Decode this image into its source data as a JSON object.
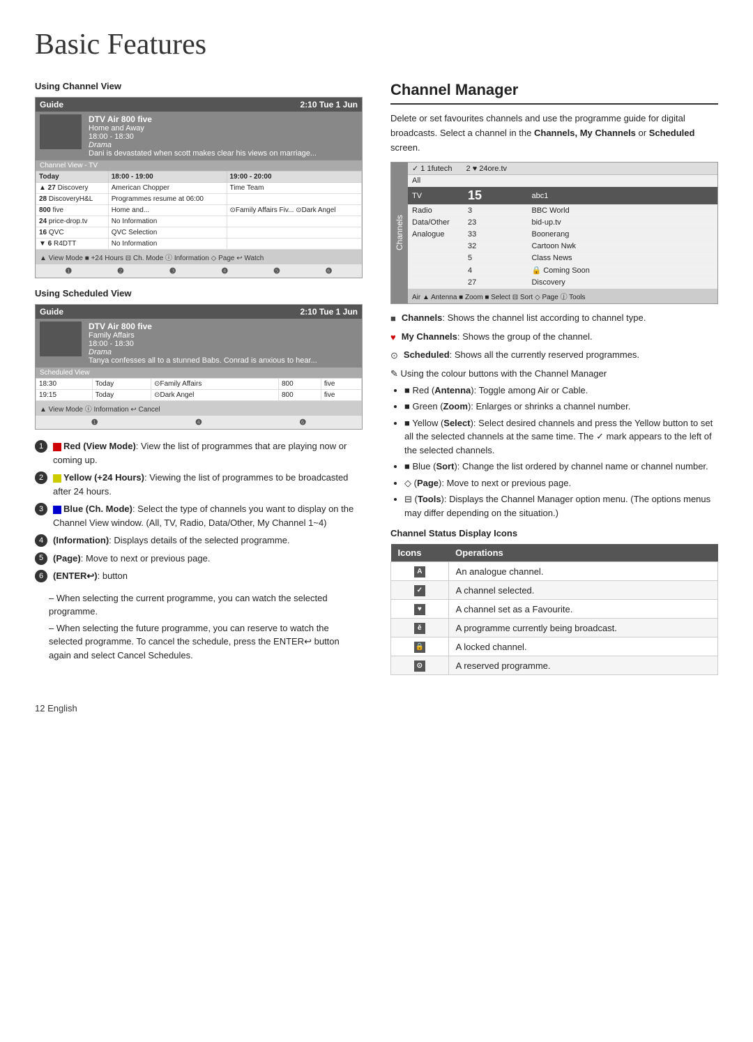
{
  "page": {
    "title": "Basic Features",
    "footer": "12   English"
  },
  "left_col": {
    "channel_view_label": "Using Channel View",
    "scheduled_view_label": "Using Scheduled View",
    "guide": {
      "header_title": "Guide",
      "header_time": "2:10 Tue 1 Jun",
      "show_title": "DTV Air 800 five",
      "show_subtitle": "Home and Away",
      "show_time": "18:00 - 18:30",
      "show_genre": "Drama",
      "show_desc": "Dani is devastated when scott makes clear his views on marriage...",
      "view_label": "Channel View - TV",
      "time_col1": "Today",
      "time_col2": "18:00 - 19:00",
      "time_col3": "19:00 - 20:00",
      "channels": [
        {
          "num": "▲ 27",
          "name": "Discovery",
          "p1": "American Chopper",
          "p2": "Time Team"
        },
        {
          "num": "28",
          "name": "DiscoveryH&L",
          "p1": "Programmes resume at 06:00",
          "p2": ""
        },
        {
          "num": "800",
          "name": "five",
          "p1": "Home and...",
          "p2": "⊙Family Affairs  Fiv...  ⊙Dark Angel"
        },
        {
          "num": "24",
          "name": "price-drop.tv",
          "p1": "No Information",
          "p2": ""
        },
        {
          "num": "16",
          "name": "QVC",
          "p1": "QVC Selection",
          "p2": ""
        },
        {
          "num": "▼ 6",
          "name": "R4DTT",
          "p1": "No Information",
          "p2": ""
        }
      ],
      "footer": "▲ View Mode  ■ +24 Hours  ⊟ Ch. Mode  ⓘ Information  ◇ Page  ↩ Watch"
    },
    "guide2": {
      "header_title": "Guide",
      "header_time": "2:10 Tue 1 Jun",
      "show_title": "DTV Air 800 five",
      "show_subtitle": "Family Affairs",
      "show_time": "18:00 - 18:30",
      "show_genre": "Drama",
      "show_desc": "Tanya confesses all to a stunned Babs. Conrad is anxious to hear...",
      "view_label": "Scheduled View",
      "scheduled_items": [
        {
          "time": "18:30",
          "day": "Today",
          "prog": "⊙Family Affairs",
          "ch": "800",
          "name": "five"
        },
        {
          "time": "19:15",
          "day": "Today",
          "prog": "⊙Dark Angel",
          "ch": "800",
          "name": "five"
        }
      ],
      "footer": "▲ View Mode  ⓘ Information  ↩ Cancel"
    },
    "numbered_items": [
      {
        "num": "1",
        "color_label": "Red",
        "color_sq": "#cc0000",
        "button_label": "View Mode",
        "desc": "View the list of programmes that are playing now or coming up."
      },
      {
        "num": "2",
        "color_label": "Yellow",
        "color_sq": "#cccc00",
        "button_label": "+24 Hours",
        "desc": "Viewing the list of programmes to be broadcasted after 24 hours."
      },
      {
        "num": "3",
        "color_label": "Blue",
        "color_sq": "#0000cc",
        "button_label": "Ch. Mode",
        "desc": "Select the type of channels you want to display on the Channel View window. (All, TV, Radio, Data/Other, My Channel 1~4)"
      },
      {
        "num": "4",
        "button_label": "Information",
        "desc": "Displays details of the selected programme."
      },
      {
        "num": "5",
        "button_label": "Page",
        "desc": "Move to next or previous page."
      },
      {
        "num": "6",
        "button_label": "ENTER↩",
        "desc": "button"
      }
    ],
    "enter_sub1": "When selecting the current programme, you can watch the selected programme.",
    "enter_sub2": "When selecting the future programme, you can reserve to watch the selected programme. To cancel the schedule, press the ENTER↩ button again and select Cancel Schedules."
  },
  "right_col": {
    "title": "Channel Manager",
    "intro": "Delete or set favourites channels and use the programme guide for digital broadcasts. Select a channel in the",
    "intro_bold": "Channels, My Channels",
    "intro2": "or",
    "intro_bold2": "Scheduled",
    "intro3": "screen.",
    "cm_box": {
      "side_label": "Channels",
      "header_check": "✓ 1   1futech",
      "header_2": "2   ♥ 24ore.tv",
      "rows": [
        {
          "label": "All",
          "num": "",
          "name": ""
        },
        {
          "label": "TV",
          "num": "15",
          "name": "abc1",
          "highlighted": true
        },
        {
          "label": "Radio",
          "num": "3",
          "name": "BBC World"
        },
        {
          "label": "Data/Other",
          "num": "23",
          "name": "bid-up.tv"
        },
        {
          "label": "Analogue",
          "num": "33",
          "name": "Boonerang"
        },
        {
          "label": "",
          "num": "32",
          "name": "Cartoon Nwk"
        },
        {
          "label": "",
          "num": "5",
          "name": "Class News"
        },
        {
          "label": "",
          "num": "4",
          "name": "🔒 Coming Soon"
        },
        {
          "label": "",
          "num": "27",
          "name": "Discovery"
        }
      ],
      "footer": "Air   ▲ Antenna  ■ Zoom  ■ Select  ⊟ Sort  ◇ Page  ⓙ Tools"
    },
    "bullets": [
      {
        "icon": "■",
        "icon_color": "#444",
        "text": "Channels: Shows the channel list according to channel type.",
        "bold": "Channels"
      },
      {
        "icon": "♥",
        "icon_color": "#c00",
        "text": "My Channels: Shows the group of the channel.",
        "bold": "My Channels"
      },
      {
        "icon": "⊙",
        "icon_color": "#444",
        "text": "Scheduled: Shows all the currently reserved programmes.",
        "bold": "Scheduled"
      }
    ],
    "colour_intro": "Using the colour buttons with the Channel Manager",
    "colour_bullets": [
      "■ Red (Antenna): Toggle among Air or Cable.",
      "■ Green (Zoom): Enlarges or shrinks a channel number.",
      "■ Yellow (Select): Select desired channels and press the Yellow button to set all the selected channels at the same time. The ✓ mark appears to the left of the selected channels.",
      "■ Blue (Sort): Change the list ordered by channel name or channel number.",
      "◇ (Page): Move to next or previous page.",
      "⊟ (Tools): Displays the Channel Manager option menu. (The options menus may differ depending on the situation.)"
    ],
    "status_section_label": "Channel Status Display Icons",
    "status_table": {
      "col1": "Icons",
      "col2": "Operations",
      "rows": [
        {
          "icon": "A",
          "desc": "An analogue channel."
        },
        {
          "icon": "✓",
          "desc": "A channel selected."
        },
        {
          "icon": "♥",
          "desc": "A channel set as a Favourite."
        },
        {
          "icon": "ě",
          "desc": "A programme currently being broadcast."
        },
        {
          "icon": "🔒",
          "desc": "A locked channel."
        },
        {
          "icon": "⊙",
          "desc": "A reserved programme."
        }
      ]
    }
  }
}
